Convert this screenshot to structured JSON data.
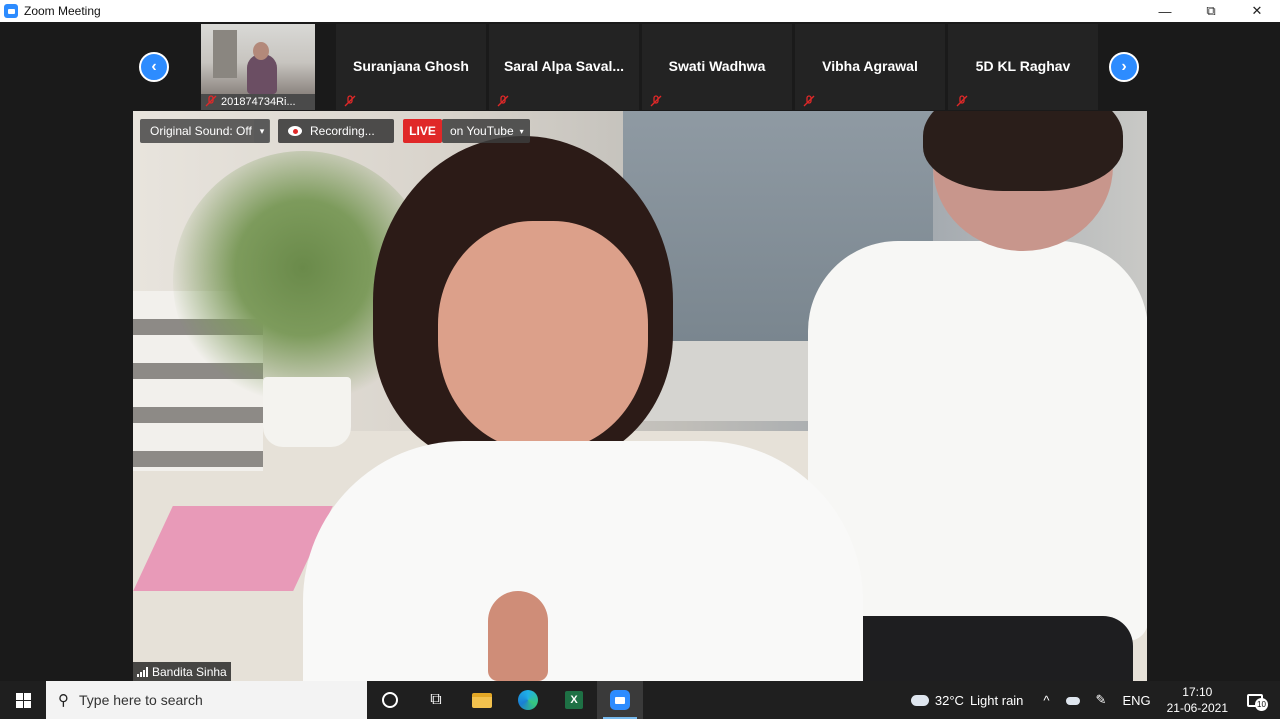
{
  "window": {
    "title": "Zoom Meeting",
    "controls": {
      "minimize": "—",
      "restore": "⧉",
      "close": "✕"
    }
  },
  "strip": {
    "prev_icon": "‹",
    "next_icon": "›",
    "video_tile": {
      "label": "201874734Ri..."
    },
    "participants": [
      {
        "name": "Suranjana Ghosh"
      },
      {
        "name": "Saral  Alpa Saval..."
      },
      {
        "name": "Swati Wadhwa"
      },
      {
        "name": "Vibha Agrawal"
      },
      {
        "name": "5D KL Raghav"
      }
    ]
  },
  "meeting_toolbar": {
    "original_sound": "Original Sound: Off",
    "sound_caret": "▾",
    "recording": "Recording...",
    "live_badge": "LIVE",
    "live_target": "on YouTube",
    "live_caret": "▾"
  },
  "active_speaker": {
    "name": "Bandita Sinha"
  },
  "taskbar": {
    "search_placeholder": "Type here to search",
    "search_icon": "⚲",
    "task_view_icon": "⧉",
    "excel_letter": "X",
    "weather": {
      "temperature": "32°C",
      "condition": "Light rain"
    },
    "tray_chevron": "^",
    "pen_icon": "✎",
    "language": "ENG",
    "time": "17:10",
    "date": "21-06-2021",
    "notification_count": "10"
  },
  "colors": {
    "accent": "#2d8cff",
    "live": "#e02828",
    "taskbar": "#1f1f1f"
  }
}
